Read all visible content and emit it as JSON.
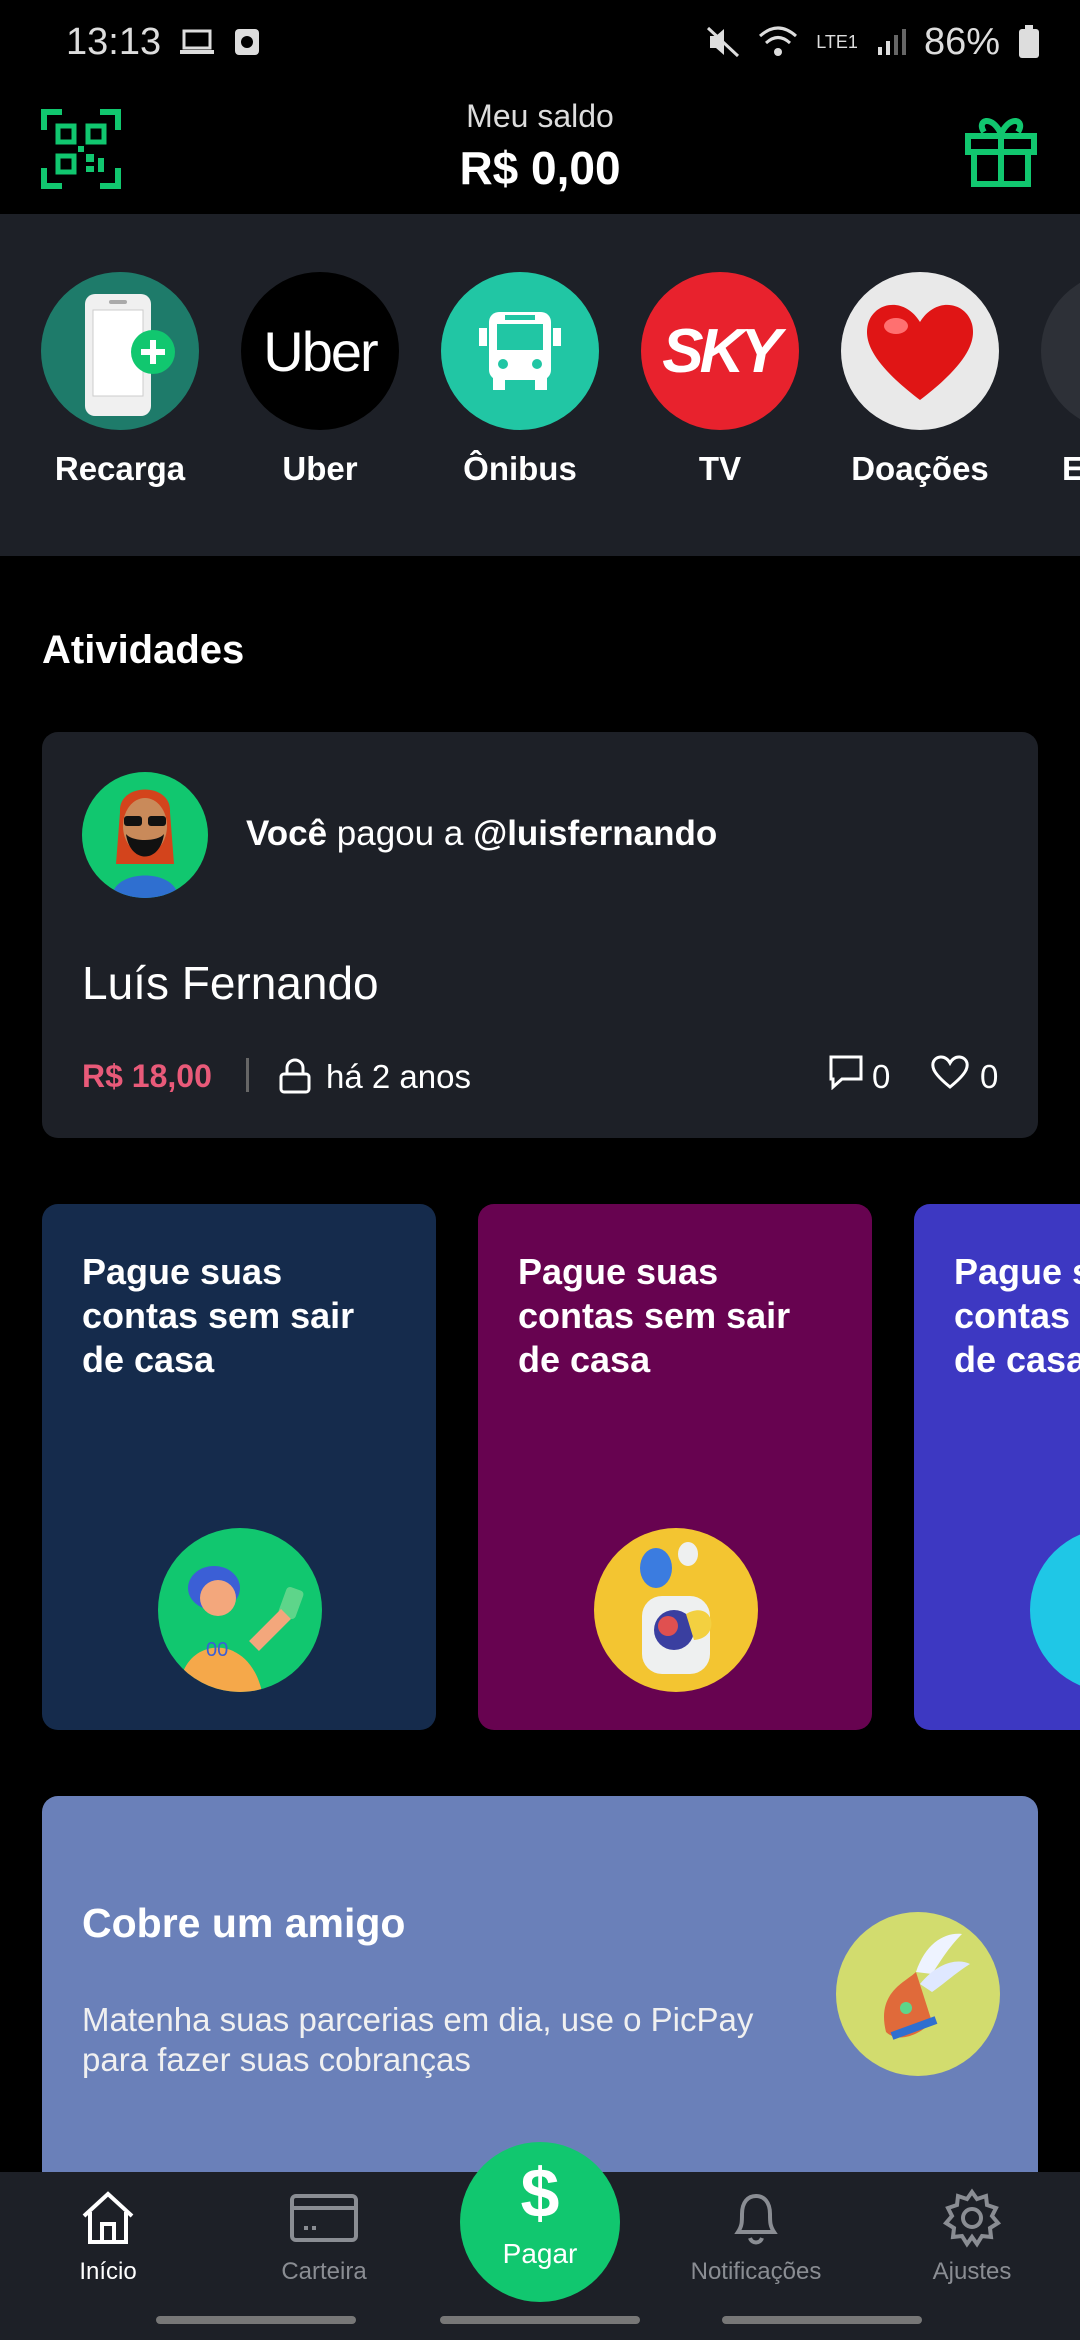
{
  "status_bar": {
    "time": "13:13",
    "battery": "86%",
    "network": "LTE1"
  },
  "header": {
    "balance_label": "Meu saldo",
    "balance_value": "R$ 0,00"
  },
  "shortcuts": [
    {
      "label": "Recarga",
      "icon": "phone-plus-icon"
    },
    {
      "label": "Uber",
      "icon": "uber-logo"
    },
    {
      "label": "Ônibus",
      "icon": "bus-icon"
    },
    {
      "label": "TV",
      "icon": "sky-logo"
    },
    {
      "label": "Doações",
      "icon": "heart-icon"
    },
    {
      "label": "E",
      "icon": "partial-icon"
    }
  ],
  "activity": {
    "section_title": "Atividades",
    "actor": "Você",
    "verb": "pagou a",
    "target": "@luisfernando",
    "recipient_name": "Luís Fernando",
    "amount": "R$ 18,00",
    "time": "há 2 anos",
    "comments": "0",
    "likes": "0"
  },
  "promos": [
    {
      "title": "Pague suas contas sem sair de casa",
      "bg": "#152b4c"
    },
    {
      "title": "Pague suas contas sem sair de casa",
      "bg": "#670350"
    },
    {
      "title": "Pague suas contas sem sair de casa",
      "bg": "#3d38c2"
    }
  ],
  "cobre": {
    "title": "Cobre um amigo",
    "description": "Matenha suas parcerias em dia, use o PicPay para fazer suas cobranças"
  },
  "bottom_nav": {
    "home": "Início",
    "wallet": "Carteira",
    "pay": "Pagar",
    "pay_symbol": "$",
    "notifications": "Notificações",
    "settings": "Ajustes"
  },
  "colors": {
    "accent": "#11c76f",
    "amount": "#e95a79",
    "card": "#1d2027"
  }
}
